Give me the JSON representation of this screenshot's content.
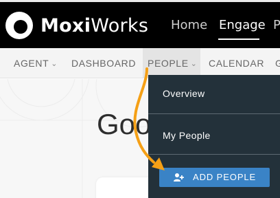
{
  "brand": {
    "name_bold": "Moxi",
    "name_regular": "Works"
  },
  "main_nav": {
    "items": [
      {
        "label": "Home",
        "active": false
      },
      {
        "label": "Engage",
        "active": true
      },
      {
        "label": "P",
        "active": false
      }
    ]
  },
  "sub_nav": {
    "items": [
      {
        "label": "AGENT",
        "has_caret": true
      },
      {
        "label": "DASHBOARD",
        "has_caret": false
      },
      {
        "label": "PEOPLE",
        "has_caret": true,
        "open": true
      },
      {
        "label": "CALENDAR",
        "has_caret": false
      },
      {
        "label": "G",
        "has_caret": false
      }
    ]
  },
  "page": {
    "greeting": "Goo"
  },
  "people_menu": {
    "items": [
      "Overview",
      "My People"
    ],
    "add_button": {
      "label": "ADD PEOPLE",
      "icon": "add-person-icon"
    }
  },
  "annotation": {
    "type": "curved-arrow",
    "color": "#f5a016"
  },
  "colors": {
    "topbar": "#000000",
    "subnav": "#f4f4f4",
    "dropdown": "#23313a",
    "button": "#3a83c6"
  }
}
